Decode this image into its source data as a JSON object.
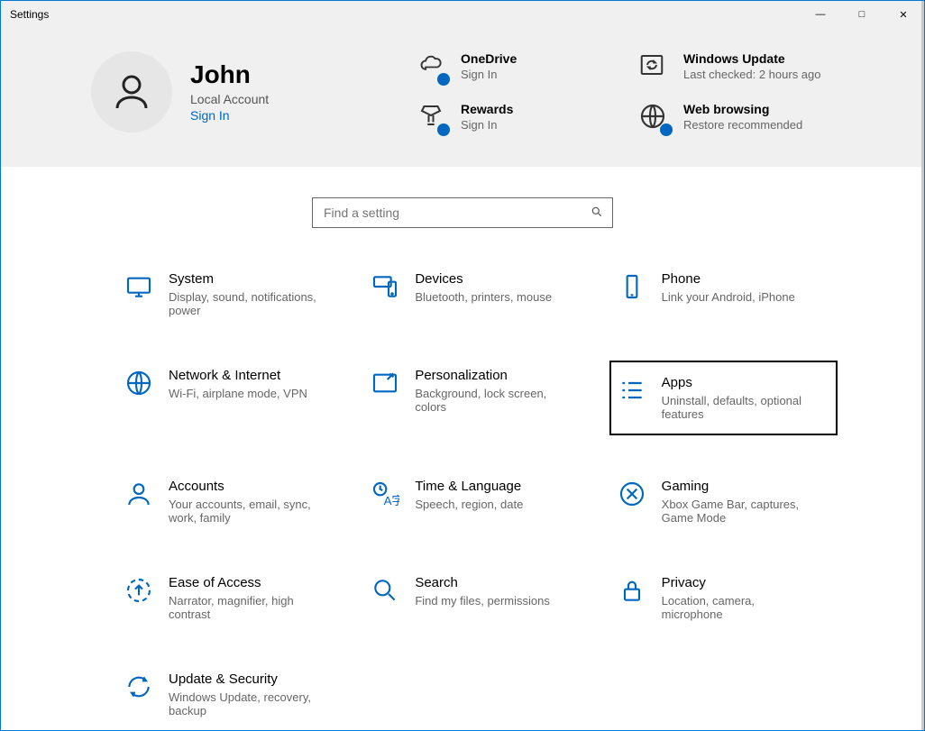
{
  "window": {
    "title": "Settings"
  },
  "account": {
    "name": "John",
    "type": "Local Account",
    "signin": "Sign In"
  },
  "header_tiles": {
    "onedrive": {
      "title": "OneDrive",
      "sub": "Sign In"
    },
    "windows_update": {
      "title": "Windows Update",
      "sub": "Last checked: 2 hours ago"
    },
    "rewards": {
      "title": "Rewards",
      "sub": "Sign In"
    },
    "web_browsing": {
      "title": "Web browsing",
      "sub": "Restore recommended"
    }
  },
  "search": {
    "placeholder": "Find a setting"
  },
  "categories": {
    "system": {
      "title": "System",
      "sub": "Display, sound, notifications, power"
    },
    "devices": {
      "title": "Devices",
      "sub": "Bluetooth, printers, mouse"
    },
    "phone": {
      "title": "Phone",
      "sub": "Link your Android, iPhone"
    },
    "network": {
      "title": "Network & Internet",
      "sub": "Wi-Fi, airplane mode, VPN"
    },
    "personalization": {
      "title": "Personalization",
      "sub": "Background, lock screen, colors"
    },
    "apps": {
      "title": "Apps",
      "sub": "Uninstall, defaults, optional features"
    },
    "accounts": {
      "title": "Accounts",
      "sub": "Your accounts, email, sync, work, family"
    },
    "time": {
      "title": "Time & Language",
      "sub": "Speech, region, date"
    },
    "gaming": {
      "title": "Gaming",
      "sub": "Xbox Game Bar, captures, Game Mode"
    },
    "ease": {
      "title": "Ease of Access",
      "sub": "Narrator, magnifier, high contrast"
    },
    "searchcat": {
      "title": "Search",
      "sub": "Find my files, permissions"
    },
    "privacy": {
      "title": "Privacy",
      "sub": "Location, camera, microphone"
    },
    "update": {
      "title": "Update & Security",
      "sub": "Windows Update, recovery, backup"
    }
  }
}
